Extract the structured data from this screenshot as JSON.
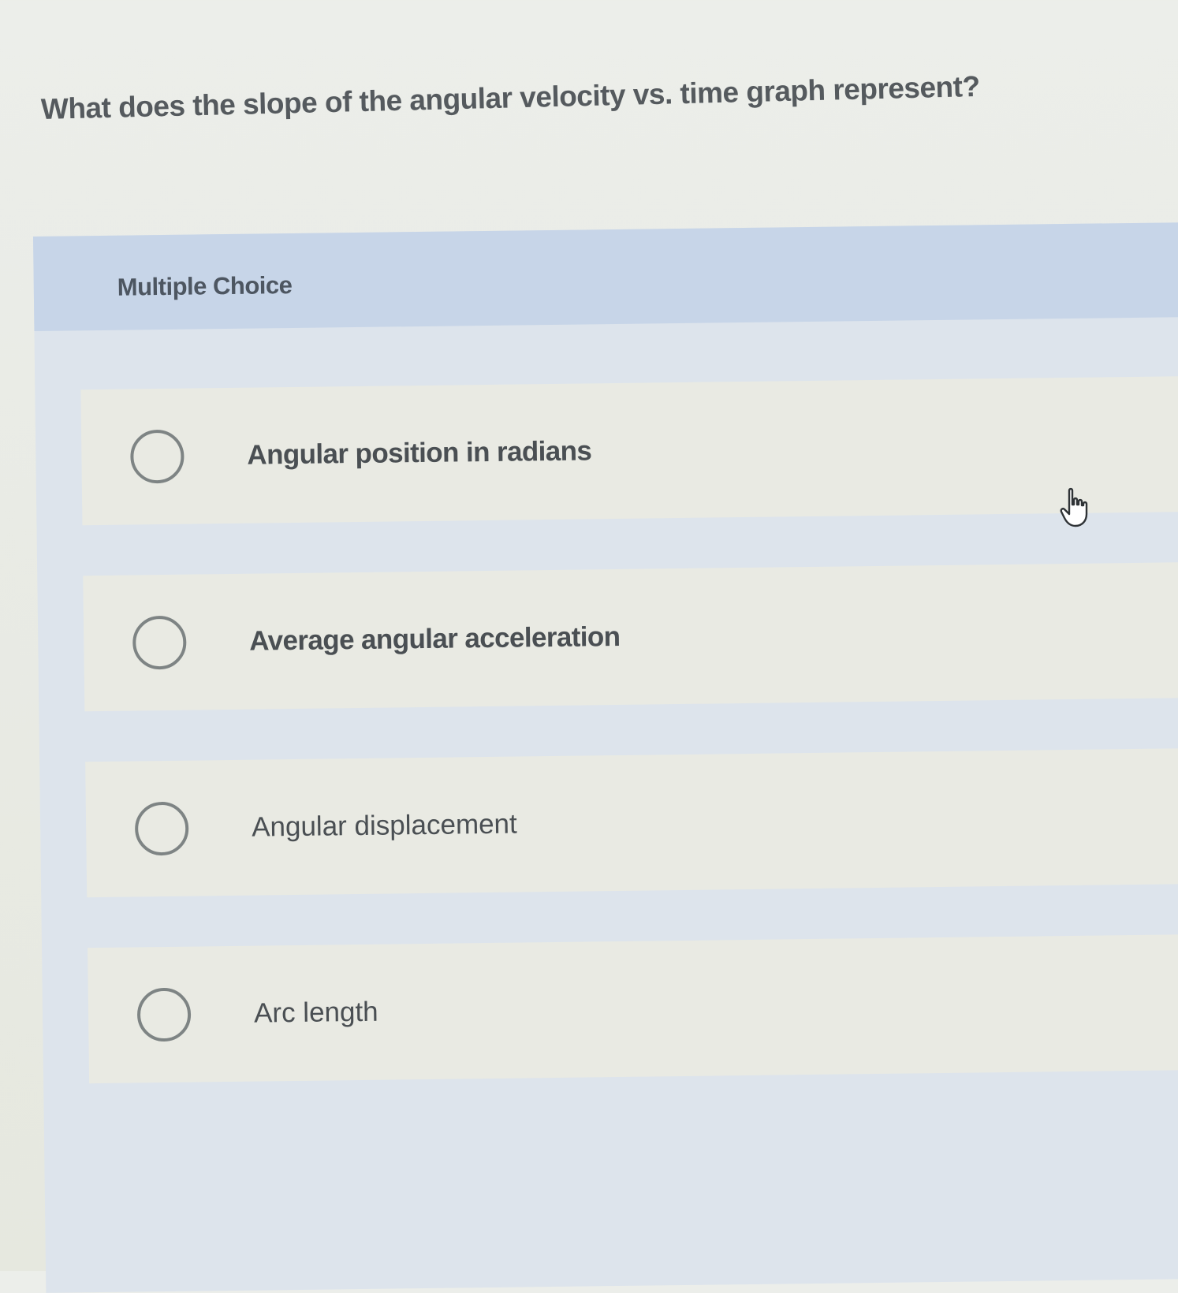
{
  "question": {
    "text": "What does the slope of the angular velocity vs. time graph represent?"
  },
  "panel": {
    "type_label": "Multiple Choice"
  },
  "options": [
    {
      "label": "Angular position in radians"
    },
    {
      "label": "Average angular acceleration"
    },
    {
      "label": "Angular displacement"
    },
    {
      "label": "Arc length"
    }
  ],
  "colors": {
    "background": "#eceeea",
    "panel": "#dde4ec",
    "panel_header": "#c7d5e8",
    "option_bg": "#e9eae3",
    "text": "#4a4f53"
  },
  "icons": {
    "cursor": "hand-pointer-icon",
    "radio": "radio-circle-icon"
  }
}
